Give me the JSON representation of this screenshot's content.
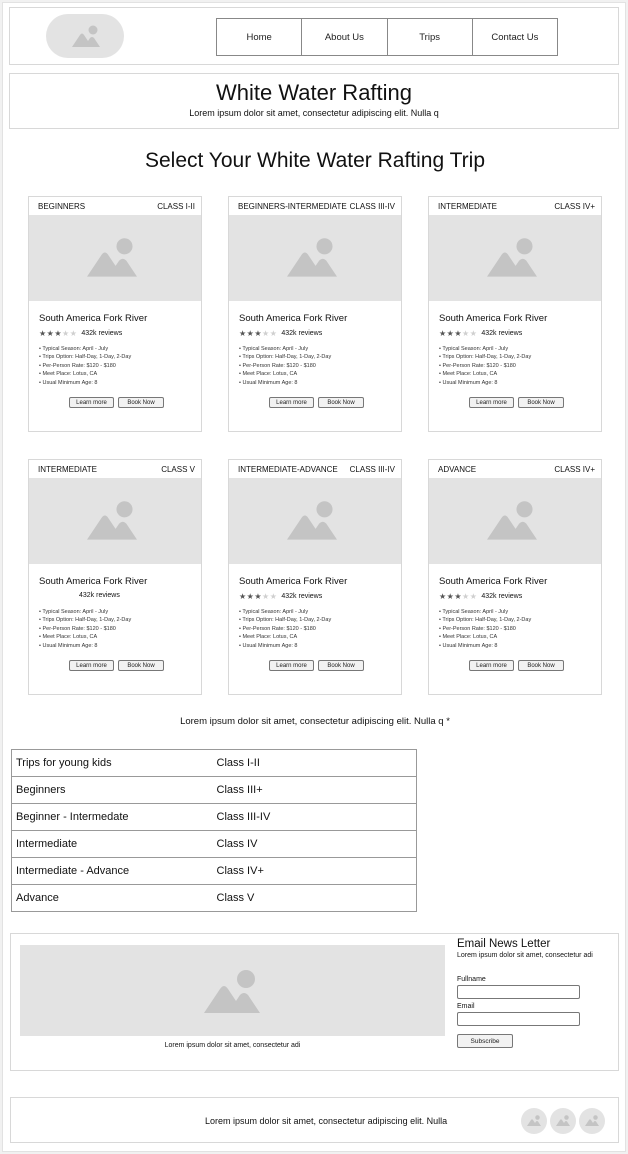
{
  "nav": {
    "items": [
      {
        "label": "Home"
      },
      {
        "label": "About Us"
      },
      {
        "label": "Trips"
      },
      {
        "label": "Contact Us"
      }
    ]
  },
  "hero": {
    "title": "White Water Rafting",
    "subtitle": "Lorem ipsum dolor sit amet, consectetur adipiscing elit. Nulla q"
  },
  "section": {
    "title": "Select Your White Water Rafting Trip"
  },
  "cards": [
    {
      "level": "BEGINNERS",
      "class": "CLASS I-II",
      "title": "South America Fork River",
      "stars": 3,
      "reviews": "432k reviews",
      "features": [
        "Typical Season: April - July",
        "Trips Option: Half-Day, 1-Day, 2-Day",
        "Per-Person Rate: $120 - $180",
        "Meet Place: Lotus, CA",
        "Usual Minimum Age: 8"
      ],
      "learn_label": "Learn more",
      "book_label": "Book Now"
    },
    {
      "level": "BEGINNERS-INTERMEDIATE",
      "class": "CLASS III-IV",
      "title": "South America Fork River",
      "stars": 3,
      "reviews": "432k reviews",
      "features": [
        "Typical Season: April - July",
        "Trips Option: Half-Day, 1-Day, 2-Day",
        "Per-Person Rate: $120 - $180",
        "Meet Place: Lotus, CA",
        "Usual Minimum Age: 8"
      ],
      "learn_label": "Learn more",
      "book_label": "Book Now"
    },
    {
      "level": "INTERMEDIATE",
      "class": "CLASS IV+",
      "title": "South America Fork River",
      "stars": 3,
      "reviews": "432k reviews",
      "features": [
        "Typical Season: April - July",
        "Trips Option: Half-Day, 1-Day, 2-Day",
        "Per-Person Rate: $120 - $180",
        "Meet Place: Lotus, CA",
        "Usual Minimum Age: 8"
      ],
      "learn_label": "Learn more",
      "book_label": "Book Now"
    },
    {
      "level": "INTERMEDIATE",
      "class": "CLASS V",
      "title": "South America Fork River",
      "stars": 0,
      "reviews": "432k reviews",
      "features": [
        "Typical Season: April - July",
        "Trips Option: Half-Day, 1-Day, 2-Day",
        "Per-Person Rate: $120 - $180",
        "Meet Place: Lotus, CA",
        "Usual Minimum Age: 8"
      ],
      "learn_label": "Learn more",
      "book_label": "Book Now"
    },
    {
      "level": "INTERMEDIATE-ADVANCE",
      "class": "CLASS  III-IV",
      "title": "South America Fork River",
      "stars": 3,
      "reviews": "432k reviews",
      "features": [
        "Typical Season: April - July",
        "Trips Option: Half-Day, 1-Day, 2-Day",
        "Per-Person Rate: $120 - $180",
        "Meet Place: Lotus, CA",
        "Usual Minimum Age: 8"
      ],
      "learn_label": "Learn more",
      "book_label": "Book Now"
    },
    {
      "level": "ADVANCE",
      "class": "CLASS  IV+",
      "title": "South America Fork River",
      "stars": 3,
      "reviews": "432k reviews",
      "features": [
        "Typical Season: April - July",
        "Trips Option: Half-Day, 1-Day, 2-Day",
        "Per-Person Rate: $120 - $180",
        "Meet Place: Lotus, CA",
        "Usual Minimum Age: 8"
      ],
      "learn_label": "Learn more",
      "book_label": "Book Now"
    }
  ],
  "middle_text": "Lorem ipsum dolor sit amet, consectetur adipiscing elit. Nulla q *",
  "class_table": [
    [
      "Trips for young kids",
      "Class I-II"
    ],
    [
      "Beginners",
      "Class III+"
    ],
    [
      "Beginner - Intermedate",
      "Class III-IV"
    ],
    [
      "Intermediate",
      "Class IV"
    ],
    [
      "Intermediate - Advance",
      "Class IV+"
    ],
    [
      "Advance",
      "Class V"
    ]
  ],
  "newsletter": {
    "caption": "Lorem ipsum dolor sit amet, consectetur adi",
    "title": "Email News Letter",
    "subtitle": "Lorem ipsum dolor sit amet, consectetur adi",
    "fullname_label": "Fullname",
    "fullname_value": "",
    "email_label": "Email",
    "email_value": "",
    "subscribe_label": "Subscribe"
  },
  "footer": {
    "text": "Lorem ipsum dolor sit amet, consectetur adipiscing elit. Nulla",
    "social_icons": [
      "image-icon",
      "image-icon",
      "image-icon"
    ]
  },
  "colors": {
    "placeholder_bg": "#e3e3e3",
    "placeholder_icon": "#c4c4c4"
  }
}
